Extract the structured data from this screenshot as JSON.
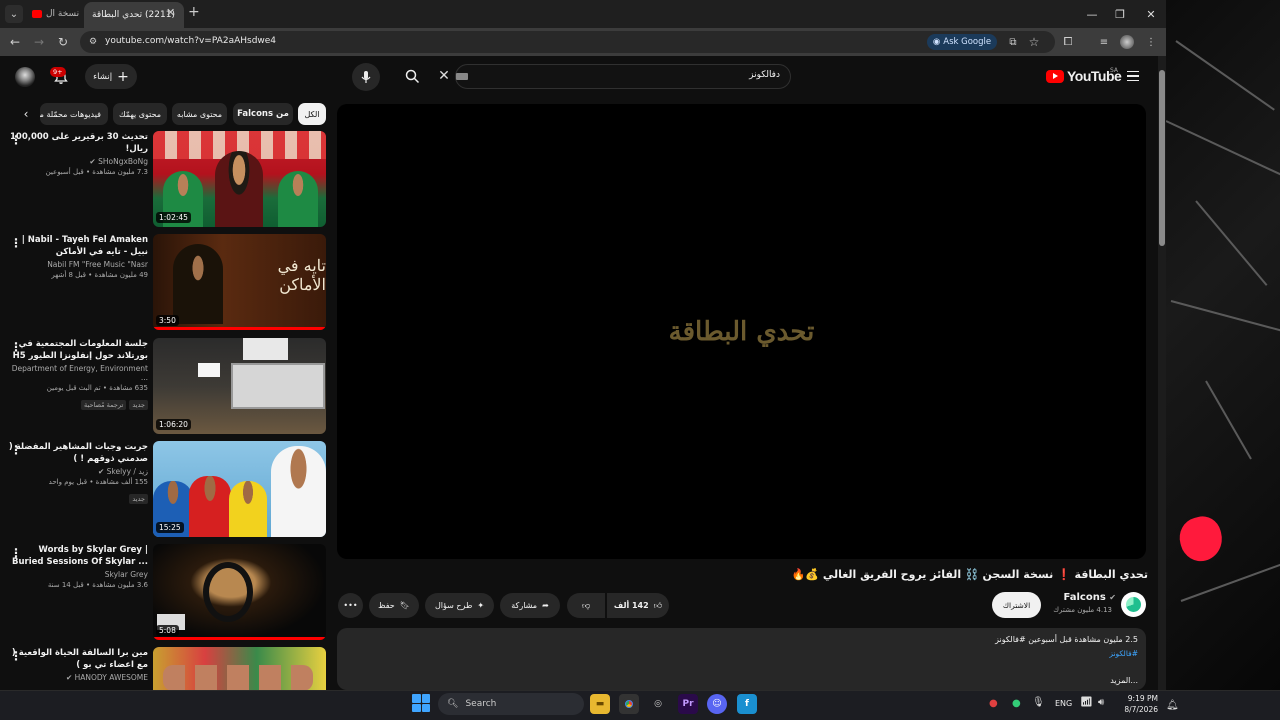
{
  "browser": {
    "tab1_title": "نسخة ال",
    "tab2_title": "(2211) تحدي البطاقة",
    "url": "youtube.com/watch?v=PA2aAHsdwe4",
    "ask_google": "Ask Google"
  },
  "header": {
    "logo_text": "YouTube",
    "region": "SA",
    "search_query": "دفالكونز",
    "create_label": "إنشاء",
    "notif_count": "9+"
  },
  "chips": {
    "all": "الكل",
    "falcons": "من Falcons",
    "related": "محتوى مشابه",
    "for_you": "محتوى يهمّك",
    "recent": "فيديوهات محمّلة مؤخرًا"
  },
  "sidebar": [
    {
      "title": "تحديث 30 برقيرير على 100,000 ريال!",
      "channel": "SHoNgxBoNg",
      "stats": "7.3 مليون مشاهدة • قبل أسبوعين",
      "duration": "1:02:45",
      "badge": ""
    },
    {
      "title": "Nabil - Tayeh Fel Amaken | نبيل - تايه في الأماكن",
      "channel": "Nabil FM \"Free Music \"Nasr",
      "stats": "49 مليون مشاهدة • قبل 8 أشهر",
      "duration": "3:50",
      "badge": ""
    },
    {
      "title": "جلسة المعلومات المجتمعية في بورتلاند حول إنفلونزا الطيور H5",
      "channel": "Department of Energy, Environment ...",
      "stats": "635 مشاهدة • تم البث قبل يومين",
      "duration": "1:06:20",
      "badge": "جديد",
      "badge2": "ترجمة مُصاحبة"
    },
    {
      "title": "جربت وجبات المشاهير المفضلة ( صدمني ذوقهم ! )",
      "channel": "زيد / Skelyy",
      "stats": "155 ألف مشاهدة • قبل يوم واحد",
      "duration": "15:25",
      "badge": "جديد"
    },
    {
      "title": "Words by Skylar Grey | Buried Sessions Of Skylar ...",
      "channel": "Skylar Grey",
      "stats": "3.6 مليون مشاهدة • قبل 14 سنة",
      "duration": "5:08",
      "badge": ""
    },
    {
      "title": "مين برا السالفة الحياة الواقعية ( مع اعضاء تي بو )",
      "channel": "HANODY AWESOME",
      "stats": "",
      "duration": "",
      "badge": ""
    }
  ],
  "player": {
    "art_text": "تحدي البطاقة"
  },
  "video": {
    "title": "تحدي البطاقة ❗ نسخة السجن ⛓️ الفائز يروح الفريق الغالي 💰🔥",
    "channel_name": "Falcons",
    "subscribers": "4.13 مليون مشترك",
    "subscribe": "الاشتراك",
    "likes": "142 ألف",
    "share": "مشاركة",
    "ask": "طرح سؤال",
    "save": "حفظ",
    "desc_stats": "2.5 مليون مشاهدة  قبل أسبوعين  #فالكونز",
    "desc_tag": "#فالكونز",
    "desc_more": "...المزيد"
  },
  "taskbar": {
    "search": "Search",
    "lang": "ENG",
    "time": "9:19 PM",
    "date": "8/7/2026"
  }
}
